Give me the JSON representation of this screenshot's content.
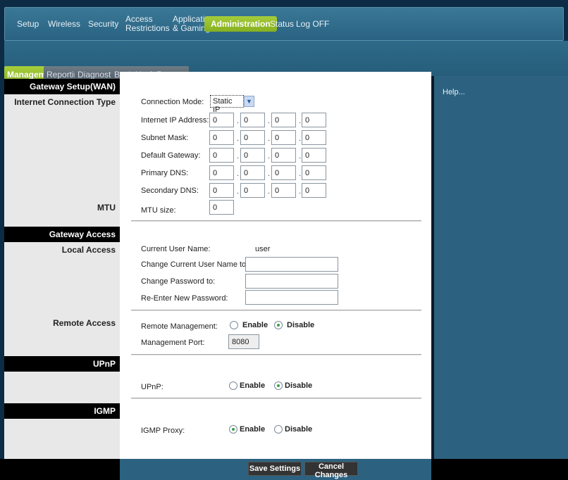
{
  "nav": {
    "items": [
      "Setup",
      "Wireless",
      "Security",
      "Access\nRestrictions",
      "Applications\n& Gaming",
      "Administration",
      "Status",
      "Log OFF"
    ],
    "active": "Administration"
  },
  "subtabs": {
    "items": [
      "Management",
      "Reporting",
      "Diagnostics",
      "Back Up & Restore"
    ],
    "active": "Management"
  },
  "sidebar": {
    "gateway_setup": "Gateway Setup(WAN)",
    "internet_connection_type": "Internet Connection Type",
    "mtu": "MTU",
    "gateway_access": "Gateway Access",
    "local_access": "Local Access",
    "remote_access": "Remote Access",
    "upnp": "UPnP",
    "igmp": "IGMP"
  },
  "wan": {
    "connection_mode_label": "Connection Mode:",
    "connection_mode": "Static IP",
    "rows": [
      {
        "label": "Internet IP Address:",
        "octets": [
          "0",
          "0",
          "0",
          "0"
        ]
      },
      {
        "label": "Subnet Mask:",
        "octets": [
          "0",
          "0",
          "0",
          "0"
        ]
      },
      {
        "label": "Default Gateway:",
        "octets": [
          "0",
          "0",
          "0",
          "0"
        ]
      },
      {
        "label": "Primary DNS:",
        "octets": [
          "0",
          "0",
          "0",
          "0"
        ]
      },
      {
        "label": "Secondary DNS:",
        "octets": [
          "0",
          "0",
          "0",
          "0"
        ]
      }
    ],
    "mtu_label": "MTU size:",
    "mtu_value": "0"
  },
  "access": {
    "current_user_label": "Current User Name:",
    "current_user": "user",
    "change_user_label": "Change Current User Name to:",
    "change_user_value": "",
    "change_password_label": "Change Password to:",
    "reenter_password_label": "Re-Enter New Password:"
  },
  "remote": {
    "label": "Remote Management:",
    "enable": "Enable",
    "disable": "Disable",
    "selected": "Disable",
    "port_label": "Management Port:",
    "port": "8080"
  },
  "upnp": {
    "label": "UPnP:",
    "enable": "Enable",
    "disable": "Disable",
    "selected": "Disable"
  },
  "igmp": {
    "label": "IGMP Proxy:",
    "enable": "Enable",
    "disable": "Disable",
    "selected": "Enable"
  },
  "help": {
    "text": "Help..."
  },
  "buttons": {
    "save": "Save Settings",
    "cancel": "Cancel Changes"
  },
  "colors": {
    "nav_bg": "#2e6a89",
    "accent_green": "#8cbc2c",
    "help_bg": "#2c6280"
  }
}
